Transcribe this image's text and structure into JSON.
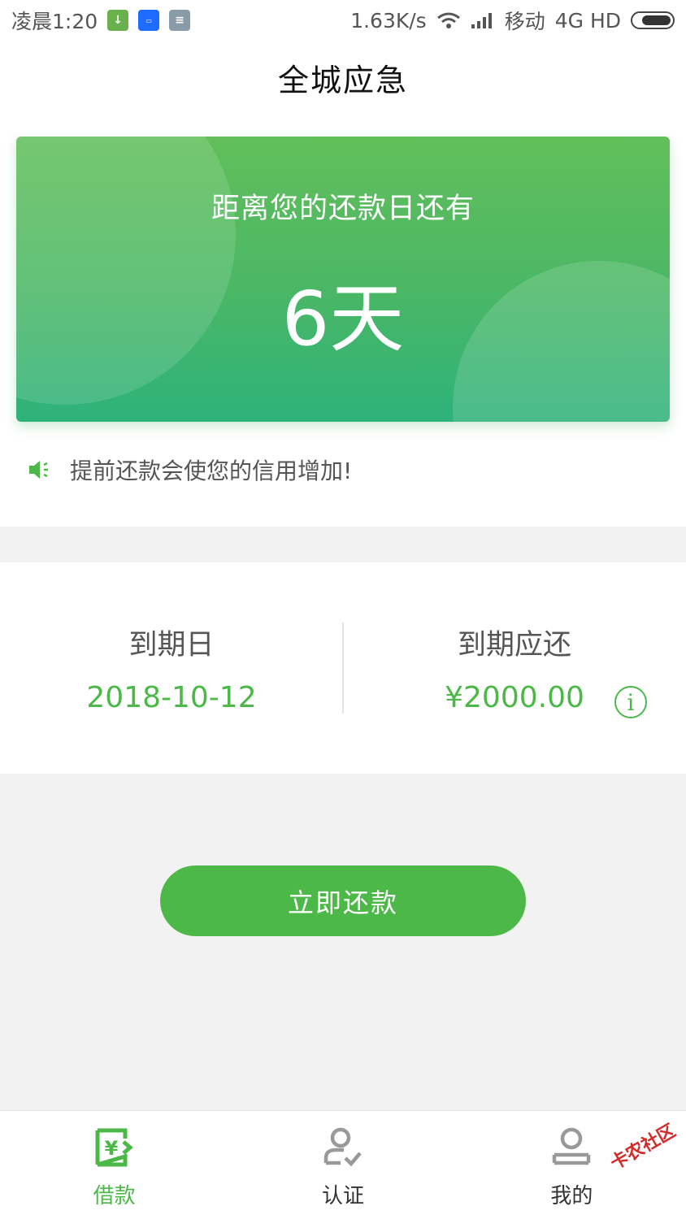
{
  "status_bar": {
    "time": "凌晨1:20",
    "network_speed": "1.63K/s",
    "carrier": "移动",
    "network_type": "4G HD"
  },
  "header": {
    "title": "全城应急"
  },
  "countdown": {
    "subtitle": "距离您的还款日还有",
    "days": "6天"
  },
  "notice": {
    "text": "提前还款会使您的信用增加!"
  },
  "due": {
    "date_label": "到期日",
    "date_value": "2018-10-12",
    "amount_label": "到期应还",
    "amount_value": "¥2000.00"
  },
  "repay_button": {
    "label": "立即还款"
  },
  "bottom_nav": {
    "items": [
      {
        "label": "借款",
        "icon": "loan-icon",
        "active": true
      },
      {
        "label": "认证",
        "icon": "verify-user-icon",
        "active": false
      },
      {
        "label": "我的",
        "icon": "profile-icon",
        "active": false
      }
    ]
  },
  "watermark": "卡农社区",
  "colors": {
    "accent": "#4cb848",
    "card_top": "#62bf5a",
    "card_bottom": "#2db27a",
    "nav_inactive": "#999999"
  }
}
